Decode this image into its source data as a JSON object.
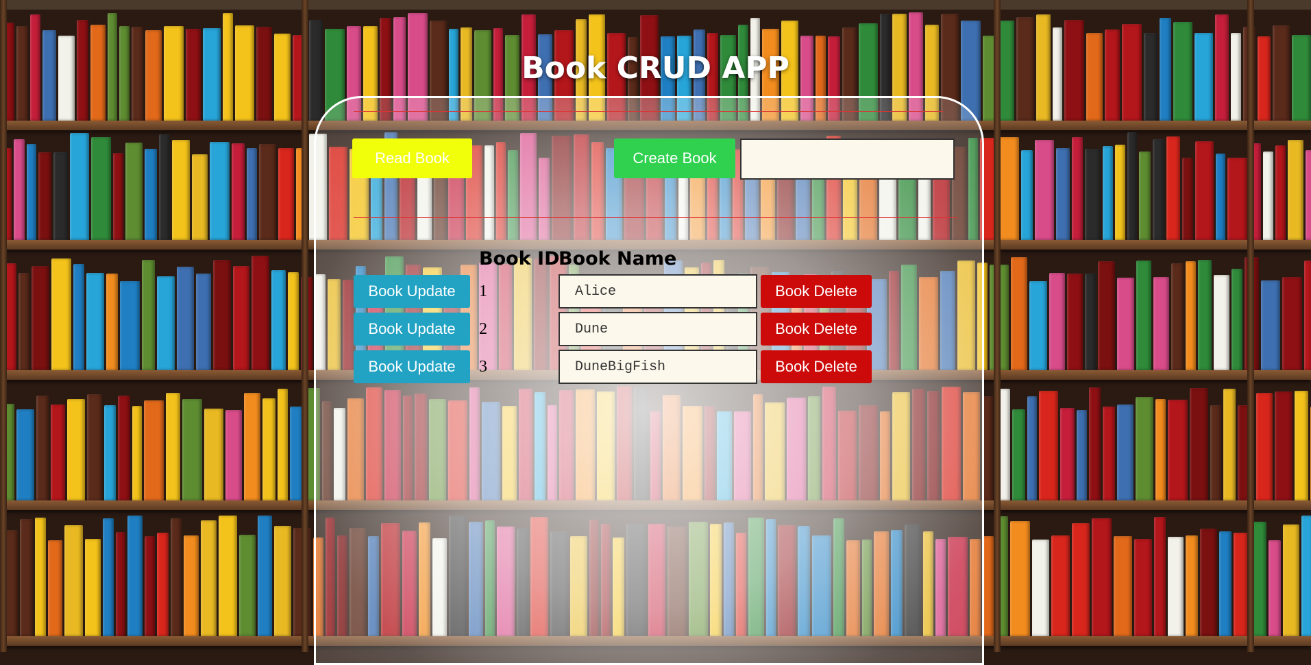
{
  "app": {
    "title": "Book CRUD APP"
  },
  "toolbar": {
    "read_label": "Read Book",
    "create_label": "Create Book",
    "create_input_value": ""
  },
  "table": {
    "headers": [
      "Book ID",
      "Book Name"
    ],
    "update_label": "Book Update",
    "delete_label": "Book Delete",
    "rows": [
      {
        "id": "1",
        "name": "Alice"
      },
      {
        "id": "2",
        "name": "Dune"
      },
      {
        "id": "3",
        "name": "DuneBigFish"
      }
    ]
  },
  "colors": {
    "read_button": "#f2ff0a",
    "create_button": "#2fd14f",
    "update_button": "#22a3c4",
    "delete_button": "#cc0a0a"
  }
}
